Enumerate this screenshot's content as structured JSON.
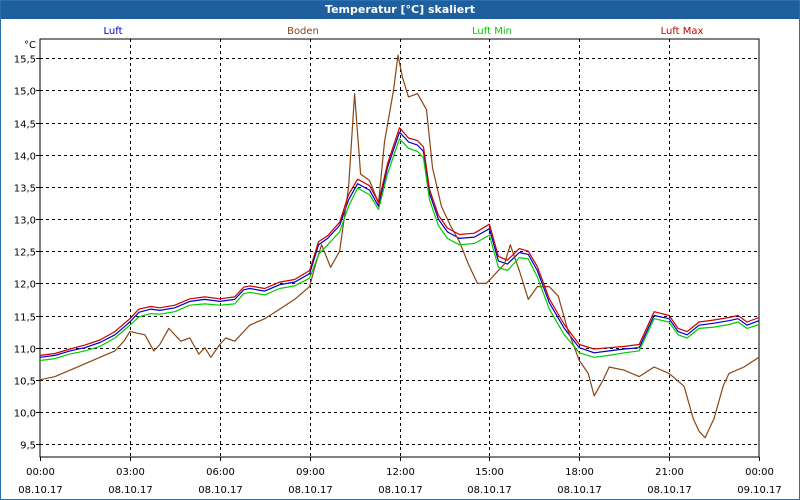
{
  "window": {
    "title": "Temperatur [°C] skaliert"
  },
  "chart_data": {
    "type": "line",
    "title": "Temperatur [°C] skaliert",
    "ylabel": "°C",
    "ylim": [
      9.3,
      15.8
    ],
    "yticks": [
      9.5,
      10.0,
      10.5,
      11.0,
      11.5,
      12.0,
      12.5,
      13.0,
      13.5,
      14.0,
      14.5,
      15.0,
      15.5
    ],
    "ytick_labels": [
      "9,5",
      "10,0",
      "10,5",
      "11,0",
      "11,5",
      "12,0",
      "12,5",
      "13,0",
      "13,5",
      "14,0",
      "14,5",
      "15,0",
      "15,5"
    ],
    "xlim": [
      0,
      24
    ],
    "xticks": [
      0,
      3,
      6,
      9,
      12,
      15,
      18,
      21,
      24
    ],
    "xtick_labels": [
      {
        "time": "00:00",
        "date": "08.10.17"
      },
      {
        "time": "03:00",
        "date": "08.10.17"
      },
      {
        "time": "06:00",
        "date": "08.10.17"
      },
      {
        "time": "09:00",
        "date": "08.10.17"
      },
      {
        "time": "12:00",
        "date": "08.10.17"
      },
      {
        "time": "15:00",
        "date": "08.10.17"
      },
      {
        "time": "18:00",
        "date": "08.10.17"
      },
      {
        "time": "21:00",
        "date": "08.10.17"
      },
      {
        "time": "00:00",
        "date": "09.10.17"
      }
    ],
    "grid": true,
    "legend_position": "top",
    "series": [
      {
        "name": "Luft",
        "color": "#0000cc",
        "points": [
          [
            0,
            10.85
          ],
          [
            0.5,
            10.88
          ],
          [
            1,
            10.95
          ],
          [
            1.5,
            11.0
          ],
          [
            2,
            11.08
          ],
          [
            2.5,
            11.2
          ],
          [
            3,
            11.4
          ],
          [
            3.3,
            11.55
          ],
          [
            3.7,
            11.6
          ],
          [
            4,
            11.58
          ],
          [
            4.5,
            11.62
          ],
          [
            5,
            11.72
          ],
          [
            5.5,
            11.75
          ],
          [
            6,
            11.72
          ],
          [
            6.5,
            11.75
          ],
          [
            6.8,
            11.9
          ],
          [
            7,
            11.92
          ],
          [
            7.5,
            11.88
          ],
          [
            8,
            11.98
          ],
          [
            8.5,
            12.02
          ],
          [
            9,
            12.15
          ],
          [
            9.3,
            12.6
          ],
          [
            9.6,
            12.7
          ],
          [
            10,
            12.9
          ],
          [
            10.3,
            13.3
          ],
          [
            10.6,
            13.55
          ],
          [
            11,
            13.45
          ],
          [
            11.3,
            13.2
          ],
          [
            11.6,
            13.8
          ],
          [
            12,
            14.35
          ],
          [
            12.3,
            14.2
          ],
          [
            12.6,
            14.15
          ],
          [
            12.8,
            14.05
          ],
          [
            13,
            13.4
          ],
          [
            13.3,
            13.0
          ],
          [
            13.6,
            12.8
          ],
          [
            14,
            12.7
          ],
          [
            14.5,
            12.72
          ],
          [
            15,
            12.85
          ],
          [
            15.3,
            12.35
          ],
          [
            15.6,
            12.3
          ],
          [
            16,
            12.48
          ],
          [
            16.3,
            12.45
          ],
          [
            16.6,
            12.2
          ],
          [
            17,
            11.7
          ],
          [
            17.5,
            11.3
          ],
          [
            18,
            11.0
          ],
          [
            18.5,
            10.92
          ],
          [
            19,
            10.95
          ],
          [
            19.5,
            10.98
          ],
          [
            20,
            11.0
          ],
          [
            20.5,
            11.5
          ],
          [
            21,
            11.45
          ],
          [
            21.3,
            11.25
          ],
          [
            21.6,
            11.2
          ],
          [
            22,
            11.35
          ],
          [
            22.5,
            11.38
          ],
          [
            23,
            11.42
          ],
          [
            23.3,
            11.45
          ],
          [
            23.6,
            11.35
          ],
          [
            24,
            11.42
          ]
        ]
      },
      {
        "name": "Boden",
        "color": "#8b4513",
        "points": [
          [
            0,
            10.5
          ],
          [
            0.5,
            10.55
          ],
          [
            1,
            10.65
          ],
          [
            1.5,
            10.75
          ],
          [
            2,
            10.85
          ],
          [
            2.5,
            10.95
          ],
          [
            2.8,
            11.1
          ],
          [
            3,
            11.25
          ],
          [
            3.5,
            11.2
          ],
          [
            3.8,
            10.95
          ],
          [
            4,
            11.05
          ],
          [
            4.3,
            11.3
          ],
          [
            4.7,
            11.1
          ],
          [
            5,
            11.15
          ],
          [
            5.3,
            10.9
          ],
          [
            5.5,
            11.0
          ],
          [
            5.7,
            10.85
          ],
          [
            6,
            11.05
          ],
          [
            6.2,
            11.15
          ],
          [
            6.5,
            11.1
          ],
          [
            6.8,
            11.25
          ],
          [
            7,
            11.35
          ],
          [
            7.5,
            11.45
          ],
          [
            8,
            11.6
          ],
          [
            8.5,
            11.75
          ],
          [
            9,
            11.95
          ],
          [
            9.2,
            12.3
          ],
          [
            9.4,
            12.6
          ],
          [
            9.7,
            12.25
          ],
          [
            10,
            12.5
          ],
          [
            10.3,
            13.5
          ],
          [
            10.5,
            14.95
          ],
          [
            10.7,
            13.7
          ],
          [
            11,
            13.6
          ],
          [
            11.3,
            13.25
          ],
          [
            11.5,
            14.2
          ],
          [
            11.8,
            15.0
          ],
          [
            11.95,
            15.55
          ],
          [
            12.1,
            15.2
          ],
          [
            12.3,
            14.9
          ],
          [
            12.6,
            14.95
          ],
          [
            12.9,
            14.7
          ],
          [
            13.1,
            13.8
          ],
          [
            13.4,
            13.2
          ],
          [
            13.7,
            12.9
          ],
          [
            14,
            12.65
          ],
          [
            14.3,
            12.3
          ],
          [
            14.6,
            12.0
          ],
          [
            14.9,
            12.0
          ],
          [
            15.2,
            12.15
          ],
          [
            15.5,
            12.3
          ],
          [
            15.7,
            12.6
          ],
          [
            16,
            12.2
          ],
          [
            16.3,
            11.75
          ],
          [
            16.6,
            11.95
          ],
          [
            17,
            11.95
          ],
          [
            17.3,
            11.8
          ],
          [
            17.6,
            11.3
          ],
          [
            18,
            10.8
          ],
          [
            18.3,
            10.6
          ],
          [
            18.5,
            10.25
          ],
          [
            18.8,
            10.5
          ],
          [
            19,
            10.7
          ],
          [
            19.5,
            10.65
          ],
          [
            20,
            10.55
          ],
          [
            20.5,
            10.7
          ],
          [
            21,
            10.6
          ],
          [
            21.5,
            10.4
          ],
          [
            21.8,
            9.9
          ],
          [
            22,
            9.7
          ],
          [
            22.2,
            9.6
          ],
          [
            22.5,
            9.9
          ],
          [
            22.8,
            10.4
          ],
          [
            23,
            10.6
          ],
          [
            23.5,
            10.7
          ],
          [
            24,
            10.85
          ]
        ]
      },
      {
        "name": "Luft Min",
        "color": "#00cc00",
        "points": [
          [
            0,
            10.8
          ],
          [
            0.5,
            10.83
          ],
          [
            1,
            10.9
          ],
          [
            1.5,
            10.95
          ],
          [
            2,
            11.02
          ],
          [
            2.5,
            11.15
          ],
          [
            3,
            11.35
          ],
          [
            3.3,
            11.48
          ],
          [
            3.7,
            11.53
          ],
          [
            4,
            11.52
          ],
          [
            4.5,
            11.56
          ],
          [
            5,
            11.66
          ],
          [
            5.5,
            11.68
          ],
          [
            6,
            11.66
          ],
          [
            6.5,
            11.68
          ],
          [
            6.8,
            11.84
          ],
          [
            7,
            11.86
          ],
          [
            7.5,
            11.82
          ],
          [
            8,
            11.92
          ],
          [
            8.5,
            11.96
          ],
          [
            9,
            12.08
          ],
          [
            9.3,
            12.45
          ],
          [
            9.6,
            12.6
          ],
          [
            10,
            12.8
          ],
          [
            10.3,
            13.2
          ],
          [
            10.6,
            13.48
          ],
          [
            11,
            13.38
          ],
          [
            11.3,
            13.15
          ],
          [
            11.6,
            13.7
          ],
          [
            12,
            14.25
          ],
          [
            12.3,
            14.1
          ],
          [
            12.6,
            14.05
          ],
          [
            12.8,
            13.95
          ],
          [
            13,
            13.3
          ],
          [
            13.3,
            12.9
          ],
          [
            13.6,
            12.7
          ],
          [
            14,
            12.6
          ],
          [
            14.5,
            12.62
          ],
          [
            15,
            12.75
          ],
          [
            15.3,
            12.25
          ],
          [
            15.6,
            12.2
          ],
          [
            16,
            12.4
          ],
          [
            16.3,
            12.38
          ],
          [
            16.6,
            12.1
          ],
          [
            17,
            11.6
          ],
          [
            17.5,
            11.2
          ],
          [
            18,
            10.92
          ],
          [
            18.5,
            10.85
          ],
          [
            19,
            10.88
          ],
          [
            19.5,
            10.92
          ],
          [
            20,
            10.95
          ],
          [
            20.5,
            11.45
          ],
          [
            21,
            11.4
          ],
          [
            21.3,
            11.2
          ],
          [
            21.6,
            11.15
          ],
          [
            22,
            11.3
          ],
          [
            22.5,
            11.32
          ],
          [
            23,
            11.36
          ],
          [
            23.3,
            11.4
          ],
          [
            23.6,
            11.3
          ],
          [
            24,
            11.36
          ]
        ]
      },
      {
        "name": "Luft Max",
        "color": "#cc0000",
        "points": [
          [
            0,
            10.88
          ],
          [
            0.5,
            10.91
          ],
          [
            1,
            10.98
          ],
          [
            1.5,
            11.04
          ],
          [
            2,
            11.12
          ],
          [
            2.5,
            11.25
          ],
          [
            3,
            11.45
          ],
          [
            3.3,
            11.6
          ],
          [
            3.7,
            11.64
          ],
          [
            4,
            11.62
          ],
          [
            4.5,
            11.66
          ],
          [
            5,
            11.76
          ],
          [
            5.5,
            11.79
          ],
          [
            6,
            11.76
          ],
          [
            6.5,
            11.79
          ],
          [
            6.8,
            11.94
          ],
          [
            7,
            11.96
          ],
          [
            7.5,
            11.92
          ],
          [
            8,
            12.02
          ],
          [
            8.5,
            12.06
          ],
          [
            9,
            12.2
          ],
          [
            9.3,
            12.65
          ],
          [
            9.6,
            12.74
          ],
          [
            10,
            12.95
          ],
          [
            10.3,
            13.38
          ],
          [
            10.6,
            13.62
          ],
          [
            11,
            13.52
          ],
          [
            11.3,
            13.26
          ],
          [
            11.6,
            13.86
          ],
          [
            12,
            14.42
          ],
          [
            12.3,
            14.26
          ],
          [
            12.6,
            14.22
          ],
          [
            12.8,
            14.12
          ],
          [
            13,
            13.46
          ],
          [
            13.3,
            13.06
          ],
          [
            13.6,
            12.86
          ],
          [
            14,
            12.76
          ],
          [
            14.5,
            12.78
          ],
          [
            15,
            12.92
          ],
          [
            15.3,
            12.42
          ],
          [
            15.6,
            12.36
          ],
          [
            16,
            12.54
          ],
          [
            16.3,
            12.5
          ],
          [
            16.6,
            12.26
          ],
          [
            17,
            11.76
          ],
          [
            17.5,
            11.36
          ],
          [
            18,
            11.05
          ],
          [
            18.5,
            10.98
          ],
          [
            19,
            11.0
          ],
          [
            19.5,
            11.02
          ],
          [
            20,
            11.05
          ],
          [
            20.5,
            11.56
          ],
          [
            21,
            11.5
          ],
          [
            21.3,
            11.3
          ],
          [
            21.6,
            11.25
          ],
          [
            22,
            11.4
          ],
          [
            22.5,
            11.43
          ],
          [
            23,
            11.47
          ],
          [
            23.3,
            11.5
          ],
          [
            23.6,
            11.4
          ],
          [
            24,
            11.47
          ]
        ]
      }
    ]
  }
}
